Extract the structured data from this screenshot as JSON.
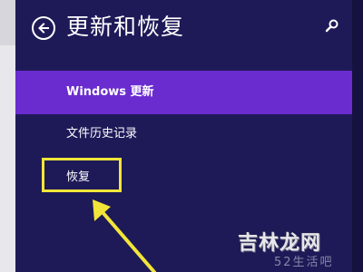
{
  "header": {
    "title": "更新和恢复",
    "back_icon": "back-arrow-icon",
    "search_icon": "search-icon"
  },
  "nav": {
    "items": [
      {
        "label": "Windows 更新",
        "selected": true
      },
      {
        "label": "文件历史记录",
        "selected": false
      },
      {
        "label": "恢复",
        "selected": false
      }
    ]
  },
  "annotation": {
    "highlight_color": "#f2e53a",
    "arrow_color": "#f2e53a"
  },
  "watermark": {
    "main": "吉林龙网",
    "sub": "52生活吧"
  },
  "colors": {
    "panel_bg": "#1e1a58",
    "selected_bg": "#6a2ccf",
    "text": "#ffffff"
  }
}
